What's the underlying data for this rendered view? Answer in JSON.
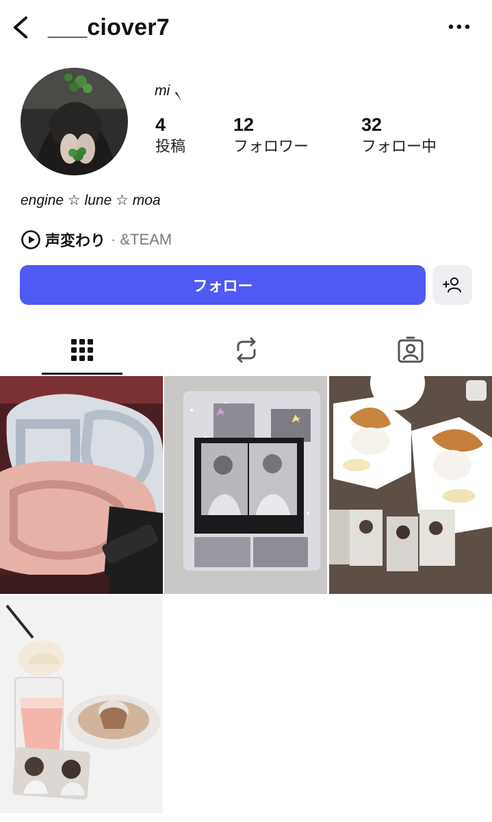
{
  "header": {
    "username": "___ciover7",
    "back_icon": "chevron-left-icon",
    "more_icon": "more-horizontal-icon"
  },
  "profile": {
    "display_name": "mi ৲",
    "stats": [
      {
        "value": "4",
        "label": "投稿"
      },
      {
        "value": "12",
        "label": "フォロワー"
      },
      {
        "value": "32",
        "label": "フォロー中"
      }
    ],
    "bio": "engine ☆ lune ☆ moa",
    "music": {
      "song": "声変わり",
      "separator": "·",
      "artist": "&TEAM"
    }
  },
  "actions": {
    "follow_label": "フォロー",
    "suggest_icon": "add-person-icon"
  },
  "tabs": [
    {
      "name": "grid",
      "icon": "grid-icon",
      "active": true
    },
    {
      "name": "reposts",
      "icon": "repost-icon",
      "active": false
    },
    {
      "name": "tagged",
      "icon": "tagged-person-icon",
      "active": false
    }
  ],
  "colors": {
    "accent": "#4e5af3",
    "secondary_button": "#eeeff2",
    "muted_text": "#7a7a80"
  }
}
